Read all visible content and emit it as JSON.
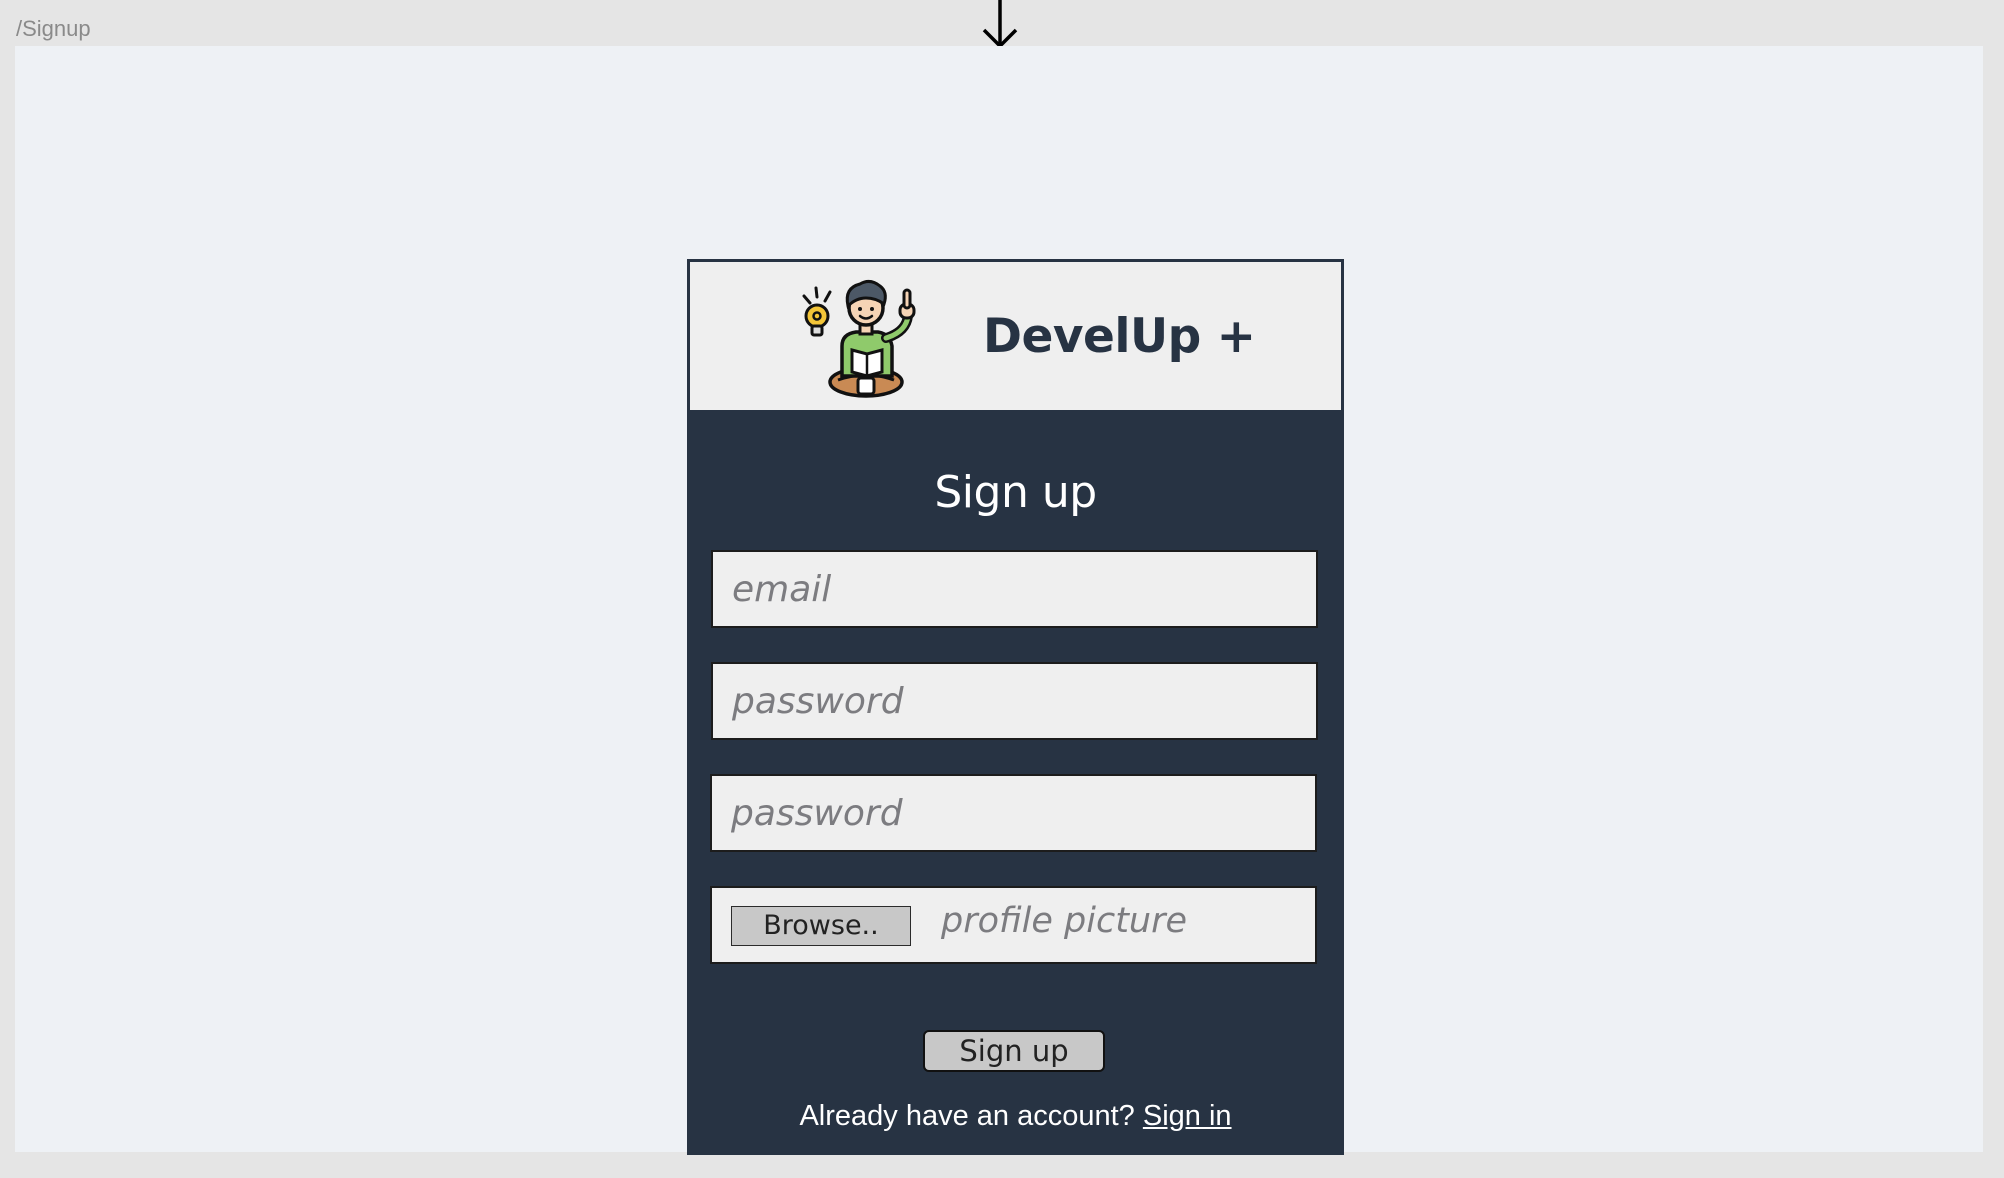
{
  "frame": {
    "label": "/Signup"
  },
  "header": {
    "brand": "DevelUp +",
    "logo_icon": "person-reading-idea-icon"
  },
  "form": {
    "title": "Sign up",
    "email_placeholder": "email",
    "password_placeholder": "password",
    "confirm_password_placeholder": "password",
    "browse_label": "Browse..",
    "file_placeholder": "profile picture",
    "submit_label": "Sign up"
  },
  "footer": {
    "prompt": "Already have an account?",
    "link_label": "Sign in"
  },
  "colors": {
    "card_background": "#273343",
    "header_background": "#efefef",
    "canvas_background": "#eef1f5",
    "input_background": "#efefef",
    "button_background": "#c8c8c8"
  }
}
